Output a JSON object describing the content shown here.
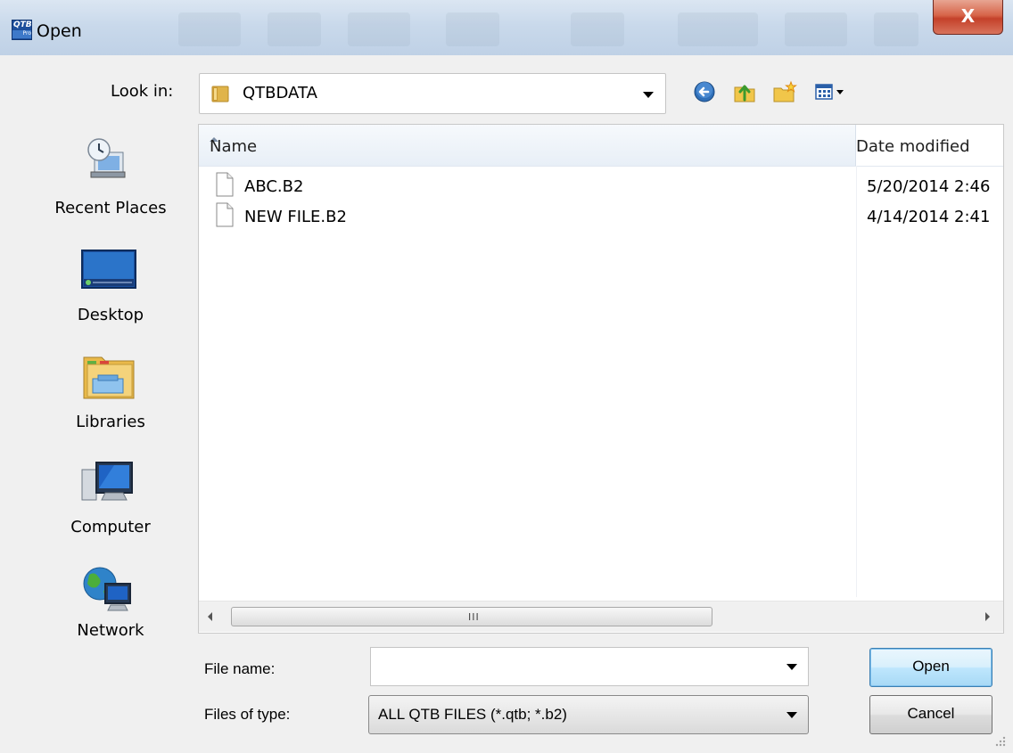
{
  "window": {
    "title": "Open",
    "app_icon": "qtb-pro-icon",
    "app_icon_text": "QTB",
    "app_icon_subtext": "Pro",
    "close_glyph": "X"
  },
  "toolbar": {
    "look_in_label": "Look in:",
    "look_in_value": "QTBDATA",
    "buttons": [
      {
        "name": "back-icon"
      },
      {
        "name": "up-folder-icon"
      },
      {
        "name": "new-folder-icon"
      },
      {
        "name": "view-menu-icon"
      }
    ]
  },
  "places": [
    {
      "label": "Recent Places",
      "icon": "recent-places-icon"
    },
    {
      "label": "Desktop",
      "icon": "desktop-icon"
    },
    {
      "label": "Libraries",
      "icon": "libraries-icon"
    },
    {
      "label": "Computer",
      "icon": "computer-icon"
    },
    {
      "label": "Network",
      "icon": "network-icon"
    }
  ],
  "file_list": {
    "columns": [
      "Name",
      "Date modified"
    ],
    "files": [
      {
        "name": "ABC.B2",
        "date": "5/20/2014 2:46"
      },
      {
        "name": "NEW FILE.B2",
        "date": "4/14/2014 2:41"
      }
    ],
    "scroll_grip": "III"
  },
  "form": {
    "file_name_label": "File name:",
    "file_name_value": "",
    "files_of_type_label": "Files of type:",
    "files_of_type_value": "ALL QTB FILES (*.qtb; *.b2)"
  },
  "buttons": {
    "open": "Open",
    "cancel": "Cancel"
  },
  "colors": {
    "titlebar": "#c9d9eb",
    "close": "#c4412a",
    "default_button": "#bee6fd"
  }
}
